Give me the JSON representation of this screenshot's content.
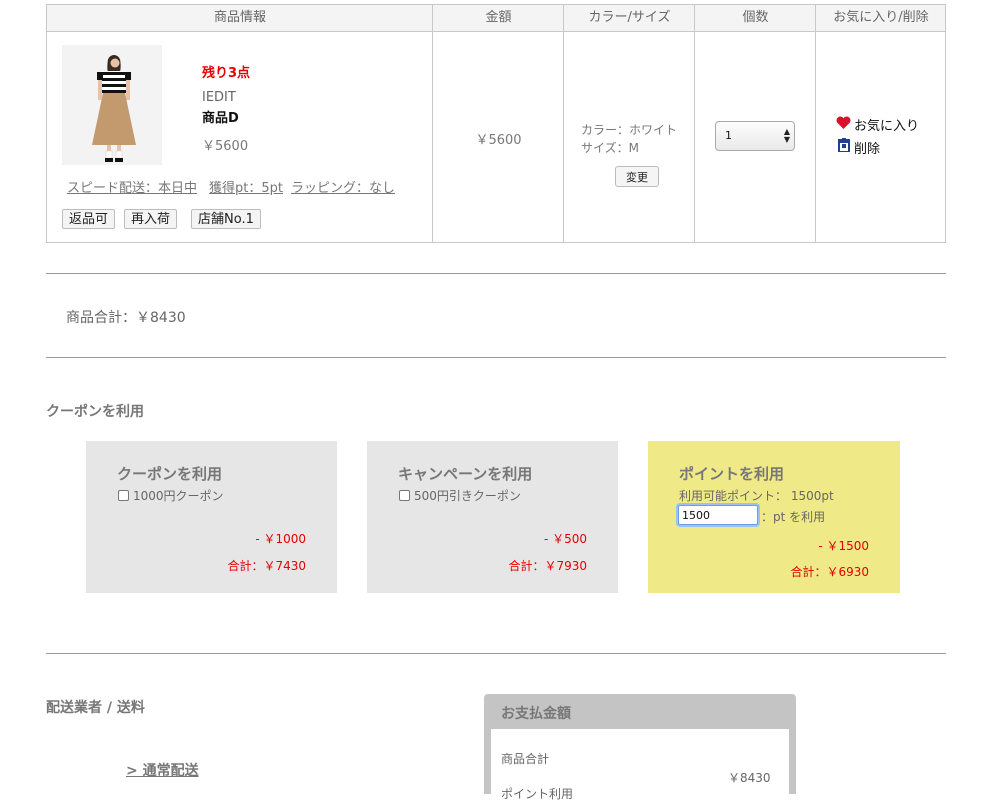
{
  "table": {
    "headers": [
      "商品情報",
      "金額",
      "カラー/サイズ",
      "個数",
      "お気に入り/削除"
    ],
    "item": {
      "stock_note": "残り3点",
      "brand": "IEDIT",
      "name": "商品D",
      "price": "￥5600",
      "amount": "￥5600",
      "color": "カラー：ホワイト",
      "size": "サイズ：M",
      "change_label": "変更",
      "quantity": "1",
      "favorite_label": "お気に入り",
      "delete_label": "削除",
      "links": [
        "スピード配送：本日中",
        "獲得pt：5pt",
        "ラッピング：なし"
      ],
      "tags": [
        "返品可",
        "再入荷",
        "店舗No.1"
      ]
    }
  },
  "subtotal": "商品合計：￥8430",
  "coupon_section": {
    "title": "クーポンを利用",
    "boxes": [
      {
        "title": "クーポンを利用",
        "option": "1000円クーポン",
        "discount": "- ￥1000",
        "total": "合計：￥7430"
      },
      {
        "title": "キャンペーンを利用",
        "option": "500円引きクーポン",
        "discount": "- ￥500",
        "total": "合計：￥7930"
      },
      {
        "title": "ポイントを利用",
        "available": "利用可能ポイント：  1500pt",
        "input_value": "1500",
        "input_suffix": "：pt を利用",
        "discount": "- ￥1500",
        "total": "合計：￥6930"
      }
    ]
  },
  "shipping": {
    "title": "配送業者 / 送料",
    "option": "> 通常配送"
  },
  "payment": {
    "title": "お支払金額",
    "subtotal_label": "商品合計",
    "subtotal_value": "￥8430",
    "next_row_label": "ポイント利用"
  },
  "colors": {
    "accent_red": "#e60000",
    "points_box": "#f0e987",
    "coupon_box": "#e6e6e6",
    "heart": "#d9122b",
    "trash": "#1f3f8f"
  }
}
